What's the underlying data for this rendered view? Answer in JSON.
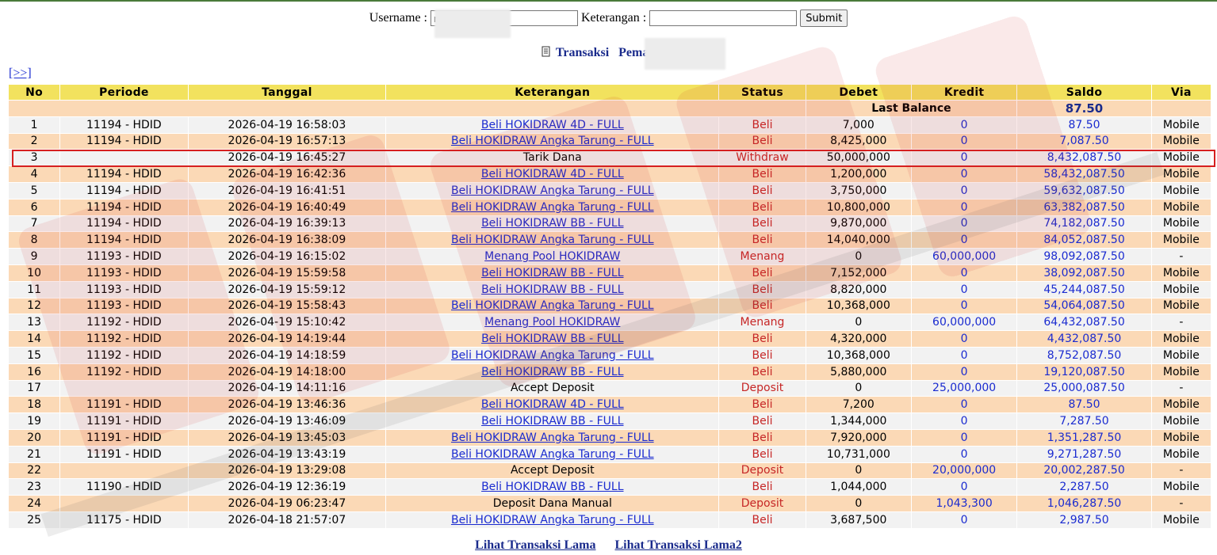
{
  "search": {
    "username_label": "Username :",
    "username_value": "r",
    "keterangan_label": "Keterangan :",
    "keterangan_value": "",
    "submit_label": "Submit"
  },
  "title": {
    "prefix": "Transaksi",
    "player_label": "Pemain :",
    "player_value": "r"
  },
  "nav": {
    "next_label": "[>>]"
  },
  "table": {
    "headers": [
      "No",
      "Periode",
      "Tanggal",
      "Keterangan",
      "Status",
      "Debet",
      "Kredit",
      "Saldo",
      "Via"
    ],
    "last_balance_label": "Last Balance",
    "last_balance_value": "87.50",
    "rows": [
      {
        "no": "1",
        "periode": "11194 - HDID",
        "tanggal": "2026-04-19 16:58:03",
        "ket": "Beli HOKIDRAW 4D - FULL",
        "link": true,
        "status": "Beli",
        "debet": "7,000",
        "kredit": "0",
        "saldo": "87.50",
        "via": "Mobile"
      },
      {
        "no": "2",
        "periode": "11194 - HDID",
        "tanggal": "2026-04-19 16:57:13",
        "ket": "Beli HOKIDRAW Angka Tarung - FULL",
        "link": true,
        "status": "Beli",
        "debet": "8,425,000",
        "kredit": "0",
        "saldo": "7,087.50",
        "via": "Mobile"
      },
      {
        "no": "3",
        "periode": "",
        "tanggal": "2026-04-19 16:45:27",
        "ket": "Tarik Dana",
        "link": false,
        "status": "Withdraw",
        "debet": "50,000,000",
        "kredit": "0",
        "saldo": "8,432,087.50",
        "via": "Mobile"
      },
      {
        "no": "4",
        "periode": "11194 - HDID",
        "tanggal": "2026-04-19 16:42:36",
        "ket": "Beli HOKIDRAW 4D - FULL",
        "link": true,
        "status": "Beli",
        "debet": "1,200,000",
        "kredit": "0",
        "saldo": "58,432,087.50",
        "via": "Mobile"
      },
      {
        "no": "5",
        "periode": "11194 - HDID",
        "tanggal": "2026-04-19 16:41:51",
        "ket": "Beli HOKIDRAW Angka Tarung - FULL",
        "link": true,
        "status": "Beli",
        "debet": "3,750,000",
        "kredit": "0",
        "saldo": "59,632,087.50",
        "via": "Mobile"
      },
      {
        "no": "6",
        "periode": "11194 - HDID",
        "tanggal": "2026-04-19 16:40:49",
        "ket": "Beli HOKIDRAW Angka Tarung - FULL",
        "link": true,
        "status": "Beli",
        "debet": "10,800,000",
        "kredit": "0",
        "saldo": "63,382,087.50",
        "via": "Mobile"
      },
      {
        "no": "7",
        "periode": "11194 - HDID",
        "tanggal": "2026-04-19 16:39:13",
        "ket": "Beli HOKIDRAW BB - FULL",
        "link": true,
        "status": "Beli",
        "debet": "9,870,000",
        "kredit": "0",
        "saldo": "74,182,087.50",
        "via": "Mobile"
      },
      {
        "no": "8",
        "periode": "11194 - HDID",
        "tanggal": "2026-04-19 16:38:09",
        "ket": "Beli HOKIDRAW Angka Tarung - FULL",
        "link": true,
        "status": "Beli",
        "debet": "14,040,000",
        "kredit": "0",
        "saldo": "84,052,087.50",
        "via": "Mobile"
      },
      {
        "no": "9",
        "periode": "11193 - HDID",
        "tanggal": "2026-04-19 16:15:02",
        "ket": "Menang Pool HOKIDRAW",
        "link": true,
        "status": "Menang",
        "debet": "0",
        "kredit": "60,000,000",
        "saldo": "98,092,087.50",
        "via": "-"
      },
      {
        "no": "10",
        "periode": "11193 - HDID",
        "tanggal": "2026-04-19 15:59:58",
        "ket": "Beli HOKIDRAW BB - FULL",
        "link": true,
        "status": "Beli",
        "debet": "7,152,000",
        "kredit": "0",
        "saldo": "38,092,087.50",
        "via": "Mobile"
      },
      {
        "no": "11",
        "periode": "11193 - HDID",
        "tanggal": "2026-04-19 15:59:12",
        "ket": "Beli HOKIDRAW BB - FULL",
        "link": true,
        "status": "Beli",
        "debet": "8,820,000",
        "kredit": "0",
        "saldo": "45,244,087.50",
        "via": "Mobile"
      },
      {
        "no": "12",
        "periode": "11193 - HDID",
        "tanggal": "2026-04-19 15:58:43",
        "ket": "Beli HOKIDRAW Angka Tarung - FULL",
        "link": true,
        "status": "Beli",
        "debet": "10,368,000",
        "kredit": "0",
        "saldo": "54,064,087.50",
        "via": "Mobile"
      },
      {
        "no": "13",
        "periode": "11192 - HDID",
        "tanggal": "2026-04-19 15:10:42",
        "ket": "Menang Pool HOKIDRAW",
        "link": true,
        "status": "Menang",
        "debet": "0",
        "kredit": "60,000,000",
        "saldo": "64,432,087.50",
        "via": "-"
      },
      {
        "no": "14",
        "periode": "11192 - HDID",
        "tanggal": "2026-04-19 14:19:44",
        "ket": "Beli HOKIDRAW BB - FULL",
        "link": true,
        "status": "Beli",
        "debet": "4,320,000",
        "kredit": "0",
        "saldo": "4,432,087.50",
        "via": "Mobile"
      },
      {
        "no": "15",
        "periode": "11192 - HDID",
        "tanggal": "2026-04-19 14:18:59",
        "ket": "Beli HOKIDRAW Angka Tarung - FULL",
        "link": true,
        "status": "Beli",
        "debet": "10,368,000",
        "kredit": "0",
        "saldo": "8,752,087.50",
        "via": "Mobile"
      },
      {
        "no": "16",
        "periode": "11192 - HDID",
        "tanggal": "2026-04-19 14:18:00",
        "ket": "Beli HOKIDRAW BB - FULL",
        "link": true,
        "status": "Beli",
        "debet": "5,880,000",
        "kredit": "0",
        "saldo": "19,120,087.50",
        "via": "Mobile"
      },
      {
        "no": "17",
        "periode": "",
        "tanggal": "2026-04-19 14:11:16",
        "ket": "Accept Deposit",
        "link": false,
        "status": "Deposit",
        "debet": "0",
        "kredit": "25,000,000",
        "saldo": "25,000,087.50",
        "via": "-"
      },
      {
        "no": "18",
        "periode": "11191 - HDID",
        "tanggal": "2026-04-19 13:46:36",
        "ket": "Beli HOKIDRAW 4D - FULL",
        "link": true,
        "status": "Beli",
        "debet": "7,200",
        "kredit": "0",
        "saldo": "87.50",
        "via": "Mobile"
      },
      {
        "no": "19",
        "periode": "11191 - HDID",
        "tanggal": "2026-04-19 13:46:09",
        "ket": "Beli HOKIDRAW BB - FULL",
        "link": true,
        "status": "Beli",
        "debet": "1,344,000",
        "kredit": "0",
        "saldo": "7,287.50",
        "via": "Mobile"
      },
      {
        "no": "20",
        "periode": "11191 - HDID",
        "tanggal": "2026-04-19 13:45:03",
        "ket": "Beli HOKIDRAW Angka Tarung - FULL",
        "link": true,
        "status": "Beli",
        "debet": "7,920,000",
        "kredit": "0",
        "saldo": "1,351,287.50",
        "via": "Mobile"
      },
      {
        "no": "21",
        "periode": "11191 - HDID",
        "tanggal": "2026-04-19 13:43:19",
        "ket": "Beli HOKIDRAW Angka Tarung - FULL",
        "link": true,
        "status": "Beli",
        "debet": "10,731,000",
        "kredit": "0",
        "saldo": "9,271,287.50",
        "via": "Mobile"
      },
      {
        "no": "22",
        "periode": "",
        "tanggal": "2026-04-19 13:29:08",
        "ket": "Accept Deposit",
        "link": false,
        "status": "Deposit",
        "debet": "0",
        "kredit": "20,000,000",
        "saldo": "20,002,287.50",
        "via": "-"
      },
      {
        "no": "23",
        "periode": "11190 - HDID",
        "tanggal": "2026-04-19 12:36:19",
        "ket": "Beli HOKIDRAW BB - FULL",
        "link": true,
        "status": "Beli",
        "debet": "1,044,000",
        "kredit": "0",
        "saldo": "2,287.50",
        "via": "Mobile"
      },
      {
        "no": "24",
        "periode": "",
        "tanggal": "2026-04-19 06:23:47",
        "ket": "Deposit Dana Manual",
        "link": false,
        "status": "Deposit",
        "debet": "0",
        "kredit": "1,043,300",
        "saldo": "1,046,287.50",
        "via": "-"
      },
      {
        "no": "25",
        "periode": "11175 - HDID",
        "tanggal": "2026-04-18 21:57:07",
        "ket": "Beli HOKIDRAW Angka Tarung - FULL",
        "link": true,
        "status": "Beli",
        "debet": "3,687,500",
        "kredit": "0",
        "saldo": "2,987.50",
        "via": "Mobile"
      }
    ]
  },
  "footer": {
    "link1": "Lihat Transaksi Lama",
    "link2": "Lihat Transaksi Lama2"
  },
  "colors": {
    "header_bg": "#f2e25e",
    "row_odd": "#f2f2f2",
    "row_even": "#fbd9b6",
    "link": "#1a2bd0",
    "status": "#c62626",
    "highlight_box": "#d62020"
  }
}
